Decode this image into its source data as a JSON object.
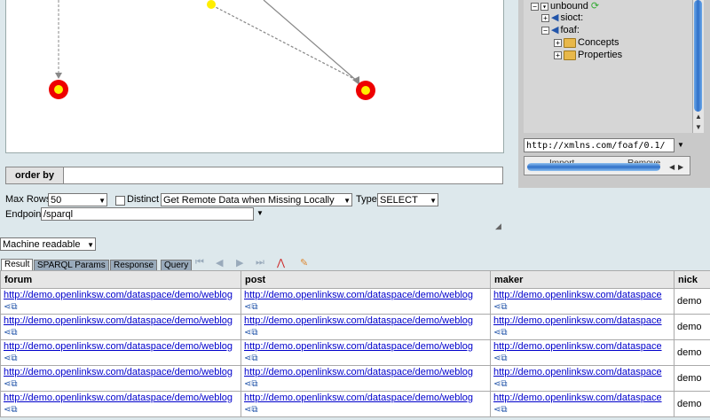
{
  "tree": {
    "root": "unbound",
    "items": [
      "sioct:",
      "foaf:",
      "Concepts",
      "Properties"
    ]
  },
  "uri_field": "http://xmlns.com/foaf/0.1/",
  "buttons": {
    "import": "Import",
    "remove": "Remove"
  },
  "order_by": {
    "label": "order by",
    "value": ""
  },
  "controls": {
    "max_rows_label": "Max Rows",
    "max_rows_value": "50",
    "distinct_label": "Distinct",
    "remote_data_value": "Get Remote Data when Missing Locally",
    "type_label": "Type",
    "type_value": "SELECT",
    "endpoint_label": "Endpoint",
    "endpoint_value": "/sparql"
  },
  "format_select": "Machine readable",
  "tabs": [
    "Result",
    "SPARQL Params",
    "Response",
    "Query"
  ],
  "table": {
    "headers": [
      "forum",
      "post",
      "maker",
      "nick"
    ],
    "rows": [
      [
        "http://demo.openlinksw.com/dataspace/demo/weblog",
        "http://demo.openlinksw.com/dataspace/demo/weblog",
        "http://demo.openlinksw.com/dataspace",
        "demo"
      ],
      [
        "http://demo.openlinksw.com/dataspace/demo/weblog",
        "http://demo.openlinksw.com/dataspace/demo/weblog",
        "http://demo.openlinksw.com/dataspace",
        "demo"
      ],
      [
        "http://demo.openlinksw.com/dataspace/demo/weblog",
        "http://demo.openlinksw.com/dataspace/demo/weblog",
        "http://demo.openlinksw.com/dataspace",
        "demo"
      ],
      [
        "http://demo.openlinksw.com/dataspace/demo/weblog",
        "http://demo.openlinksw.com/dataspace/demo/weblog",
        "http://demo.openlinksw.com/dataspace",
        "demo"
      ],
      [
        "http://demo.openlinksw.com/dataspace/demo/weblog",
        "http://demo.openlinksw.com/dataspace/demo/weblog",
        "http://demo.openlinksw.com/dataspace",
        "demo"
      ]
    ]
  }
}
